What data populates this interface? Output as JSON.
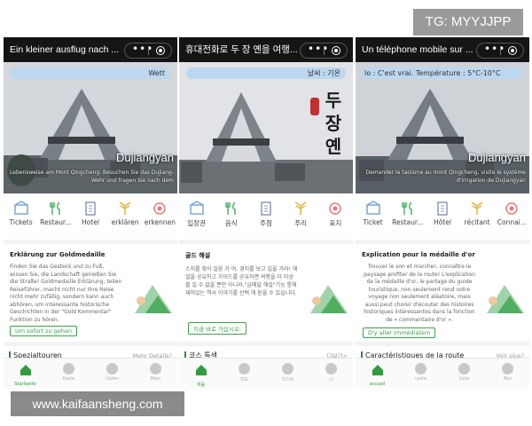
{
  "top_tag": "TG: MYYJJPP",
  "watermark": "www.kaifaansheng.com",
  "phones": [
    {
      "title": "Ein kleiner ausflug nach ...",
      "weather": "Wett",
      "place": "Dujiangyan",
      "intro": "Lebensweise am Mont Qingcheng. Besuchen Sie das Dujiang-Wehr und fragen Sie nach dem",
      "quick": [
        "Tickets",
        "Restaur...",
        "Hotel",
        "erklären",
        "erkennen"
      ],
      "card_title": "Erklärung zur Goldmedaille",
      "card_body": "Finden Sie das Gesteck und zu Fuß, wissen Sie, die Landschaft genießen Sie die Straße! Goldmedaille Erklärung, teilen Reiseführer, macht nicht nur Ihre Reise nicht mehr zufällig, sondern kann auch abhören, um interessante historische Geschichten in der \"Gold Kommentar\" Funktion zu hören.",
      "card_button": "Um sofort zu gehen",
      "section_title": "Spezialtouren",
      "section_more": "Mehr Details?",
      "tabs": [
        "Startseite",
        "Karte",
        "Listen",
        "Mein"
      ]
    },
    {
      "title": "휴대전화로 두 장 옌을 여행...",
      "weather": "날씨 : 기온",
      "kor_title": "두장옌",
      "quick": [
        "입장권",
        "음식",
        "주점",
        "푸리",
        "표지"
      ],
      "card_title": "골드 해설",
      "card_body": "스치를 찾아 걸음 가 여, 경치를 보고 길을 가라! 해설을 공유하고 가이드를 공유하면 여행을 더 이상 즐 길 수 없을 뿐만 아니라,\"금메달 해설\"기능 통해 재미있는 역사 이야기를 선택 해 듣을 수 있습니다.",
      "card_button": "지금 바로 가십시오.",
      "section_title": "코스 특색",
      "section_more": "다보기>",
      "tabs": [
        "처음",
        "지도",
        "리스트",
        "나"
      ]
    },
    {
      "title": "Un téléphone mobile sur ...",
      "weather": "lo : C'est vrai. Température : 5°C-10°C",
      "place": "Dujiangyan",
      "intro": "Demander le taoïsme au mont Qingcheng, visite le système d'irrigation de Dujiangyan",
      "quick": [
        "Ticket",
        "Restaur...",
        "Hôtel",
        "récitant",
        "Connai..."
      ],
      "card_title": "Explication pour la médaille d'or",
      "card_body": "Trouver le son et marcher, connaître le paysage profiter de la route! L'explication de la médaille d'or, le partage du guide touristique, non seulement rend votre voyage non seulement aléatoire, mais aussi peut choisir d'écouter des histoires historiques intéressantes dans la fonction de « commentaire d'or ».",
      "card_button": "D'y aller immédiatem",
      "section_title": "Caractéristiques de la route",
      "section_more": "Voir plus?",
      "tabs": [
        "accueil",
        "carte",
        "Liste",
        "Moi"
      ]
    }
  ],
  "colors": {
    "accent_green": "#2f9a3e",
    "title_bar": "#151515",
    "weather_pill": "#bcd7f0"
  }
}
